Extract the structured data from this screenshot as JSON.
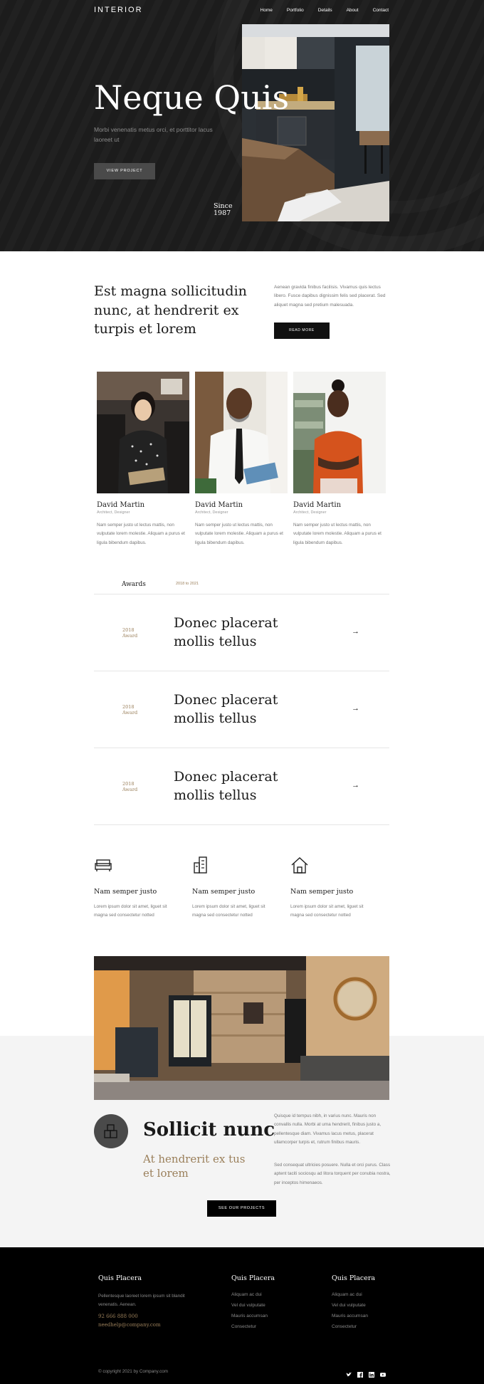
{
  "brand": {
    "logo": "INTERIOR"
  },
  "nav": [
    "Home",
    "Portfolio",
    "Details",
    "About",
    "Contact"
  ],
  "hero": {
    "title": "Neque Quis",
    "subtitle": "Morbi venenatis metus orci, et porttitor lacus laoreet ut",
    "button": "VIEW PROJECT",
    "since_line1": "Since",
    "since_line2": "1987"
  },
  "intro": {
    "title": "Est magna sollicitudin nunc, at hendrerit ex turpis et lorem",
    "text": "Aenean gravida finibus facilisis. Vivamus quis lectus libero. Fusce dapibus dignissim felis sed placerat. Sed aliquet magna sed pretium malesuada.",
    "button": "READ MORE"
  },
  "team": [
    {
      "name": "David Martin",
      "role": "Architect, Designer",
      "desc": "Nam semper justo ut lectus mattis, non vulputate lorem molestie. Aliquam a purus et ligula bibendum dapibus."
    },
    {
      "name": "David Martin",
      "role": "Architect, Designer",
      "desc": "Nam semper justo ut lectus mattis, non vulputate lorem molestie. Aliquam a purus et ligula bibendum dapibus."
    },
    {
      "name": "David Martin",
      "role": "Architect, Designer",
      "desc": "Nam semper justo ut lectus mattis, non vulputate lorem molestie. Aliquam a purus et ligula bibendum dapibus."
    }
  ],
  "awards": {
    "label": "Awards",
    "range": "2018 to 2021",
    "items": [
      {
        "year": "2018",
        "kind": "Award",
        "title": "Donec placerat mollis tellus"
      },
      {
        "year": "2018",
        "kind": "Award",
        "title": "Donec placerat mollis tellus"
      },
      {
        "year": "2018",
        "kind": "Award",
        "title": "Donec placerat mollis tellus"
      }
    ]
  },
  "features": [
    {
      "icon": "sofa-icon",
      "title": "Nam semper justo",
      "desc": "Lorem ipsum dolor sit amet, liguet sit magna sed consectetur notted"
    },
    {
      "icon": "buildings-icon",
      "title": "Nam semper justo",
      "desc": "Lorem ipsum dolor sit amet, liguet sit magna sed consectetur notted"
    },
    {
      "icon": "house-icon",
      "title": "Nam semper justo",
      "desc": "Lorem ipsum dolor sit amet, liguet sit magna sed consectetur notted"
    }
  ],
  "project": {
    "title": "Sollicit nunc",
    "subtitle": "At hendrerit ex tus et lorem",
    "p1": "Quisque id tempus nibh, in varius nunc. Mauris non convallis nulla. Morbi at urna hendrerit, finibus justo a, pellentesque diam. Vivamus lacus metus, placerat ullamcorper turpis et, rutrum finibus mauris.",
    "p2": "Sed consequat ultricies posuere. Nulla et orci purus. Class aptent taciti sociosqu ad litora torquent per conubia nostra, per inceptos himenaeos.",
    "button": "SEE OUR PROJECTS"
  },
  "footer": {
    "col1": {
      "title": "Quis Placera",
      "text": "Pellentesque laoreet lorem ipsum sit blandit venenatis. Aenean.",
      "phone": "92 666 888 000",
      "email": "needhelp@company.com"
    },
    "col2": {
      "title": "Quis Placera",
      "links": [
        "Aliquam ac dui",
        "Vel dui vulputate",
        "Mauris accumsan",
        "Consectetur"
      ]
    },
    "col3": {
      "title": "Quis Placera",
      "links": [
        "Aliquam ac dui",
        "Vel dui vulputate",
        "Mauris accumsan",
        "Consectetur"
      ]
    },
    "copyright": "© copyright 2021 by Company.com",
    "social": [
      "twitter-icon",
      "facebook-icon",
      "linkedin-icon",
      "youtube-icon"
    ]
  },
  "colors": {
    "accent": "#9a7f5a",
    "dark": "#1c1c1c",
    "button": "#111111"
  }
}
